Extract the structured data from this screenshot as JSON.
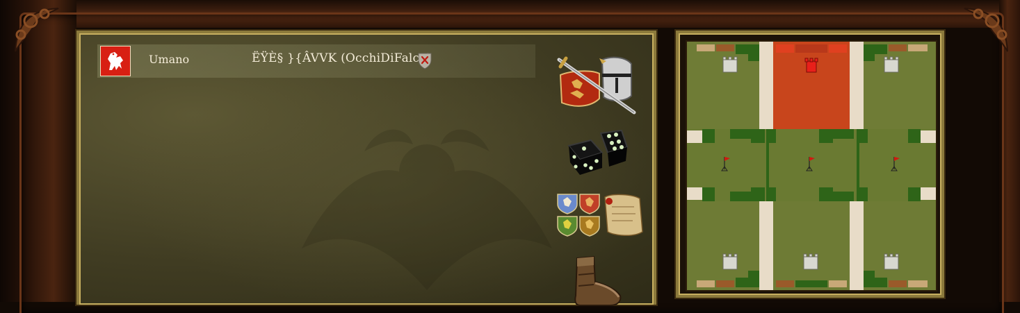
{
  "lobby": {
    "player": {
      "type": "Umano",
      "name": "ËŸÈ§ }{ÂVVK (OcchiDiFalco)",
      "flag_color": "#d81f13"
    },
    "icons": {
      "battle": "sword-shield-helmet-icon",
      "dice": "dice-icon",
      "teams": "team-shields-scroll-icon",
      "kick": "boot-icon",
      "remove_player": "shield-cross-icon"
    }
  },
  "map": {
    "grid_color": "#6e7b35",
    "selected_color": "#c8451c",
    "road_color": "#e8dcc8",
    "forest_color": "#2e6418"
  },
  "colors": {
    "frame_gold": "#8c7a3c",
    "panel_olive": "#403c22",
    "text": "#f4ecd8"
  }
}
